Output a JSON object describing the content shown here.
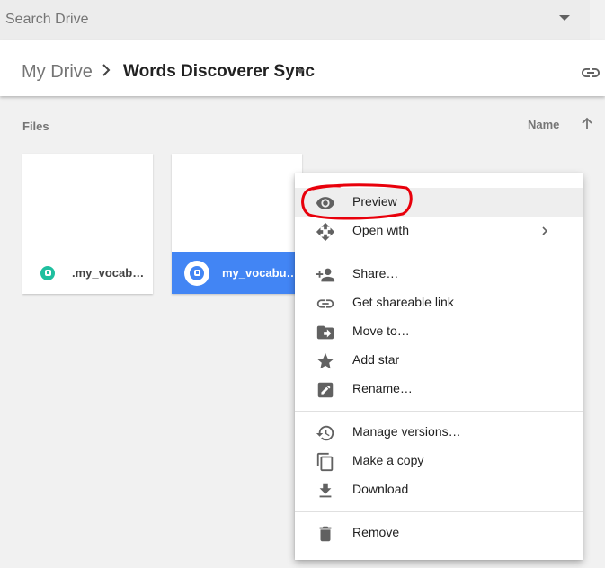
{
  "search": {
    "placeholder": "Search Drive",
    "value": ""
  },
  "breadcrumb": {
    "root": "My Drive",
    "current": "Words Discoverer Sync"
  },
  "files_header": {
    "label": "Files",
    "sort_label": "Name"
  },
  "files": [
    {
      "name": ".my_vocab…",
      "selected": false
    },
    {
      "name": "my_vocabu…",
      "selected": true
    }
  ],
  "menu": {
    "items": [
      {
        "label": "Preview",
        "icon": "eye-icon"
      },
      {
        "label": "Open with",
        "icon": "open-with-icon"
      },
      {
        "label": "Share…",
        "icon": "add-person-icon"
      },
      {
        "label": "Get shareable link",
        "icon": "link-icon"
      },
      {
        "label": "Move to…",
        "icon": "move-folder-icon"
      },
      {
        "label": "Add star",
        "icon": "star-icon"
      },
      {
        "label": "Rename…",
        "icon": "rename-icon"
      },
      {
        "label": "Manage versions…",
        "icon": "history-icon"
      },
      {
        "label": "Make a copy",
        "icon": "copy-icon"
      },
      {
        "label": "Download",
        "icon": "download-icon"
      },
      {
        "label": "Remove",
        "icon": "trash-icon"
      }
    ]
  },
  "colors": {
    "selected": "#4285f4",
    "annotation": "#e8000b",
    "app_icon": "#1fbf9f"
  }
}
